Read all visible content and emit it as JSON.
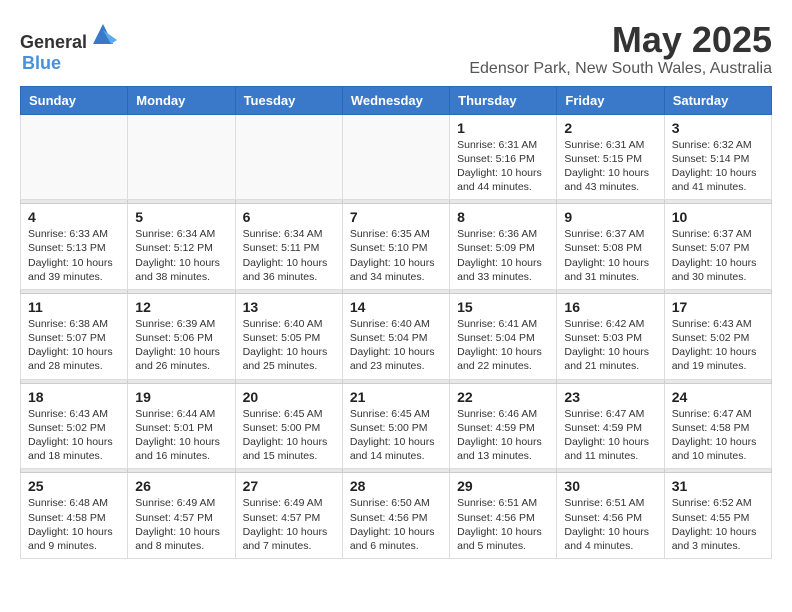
{
  "header": {
    "logo_general": "General",
    "logo_blue": "Blue",
    "month_title": "May 2025",
    "location": "Edensor Park, New South Wales, Australia"
  },
  "weekdays": [
    "Sunday",
    "Monday",
    "Tuesday",
    "Wednesday",
    "Thursday",
    "Friday",
    "Saturday"
  ],
  "weeks": [
    [
      {
        "day": "",
        "empty": true
      },
      {
        "day": "",
        "empty": true
      },
      {
        "day": "",
        "empty": true
      },
      {
        "day": "",
        "empty": true
      },
      {
        "day": "1",
        "sunrise": "Sunrise: 6:31 AM",
        "sunset": "Sunset: 5:16 PM",
        "daylight": "Daylight: 10 hours and 44 minutes."
      },
      {
        "day": "2",
        "sunrise": "Sunrise: 6:31 AM",
        "sunset": "Sunset: 5:15 PM",
        "daylight": "Daylight: 10 hours and 43 minutes."
      },
      {
        "day": "3",
        "sunrise": "Sunrise: 6:32 AM",
        "sunset": "Sunset: 5:14 PM",
        "daylight": "Daylight: 10 hours and 41 minutes."
      }
    ],
    [
      {
        "day": "4",
        "sunrise": "Sunrise: 6:33 AM",
        "sunset": "Sunset: 5:13 PM",
        "daylight": "Daylight: 10 hours and 39 minutes."
      },
      {
        "day": "5",
        "sunrise": "Sunrise: 6:34 AM",
        "sunset": "Sunset: 5:12 PM",
        "daylight": "Daylight: 10 hours and 38 minutes."
      },
      {
        "day": "6",
        "sunrise": "Sunrise: 6:34 AM",
        "sunset": "Sunset: 5:11 PM",
        "daylight": "Daylight: 10 hours and 36 minutes."
      },
      {
        "day": "7",
        "sunrise": "Sunrise: 6:35 AM",
        "sunset": "Sunset: 5:10 PM",
        "daylight": "Daylight: 10 hours and 34 minutes."
      },
      {
        "day": "8",
        "sunrise": "Sunrise: 6:36 AM",
        "sunset": "Sunset: 5:09 PM",
        "daylight": "Daylight: 10 hours and 33 minutes."
      },
      {
        "day": "9",
        "sunrise": "Sunrise: 6:37 AM",
        "sunset": "Sunset: 5:08 PM",
        "daylight": "Daylight: 10 hours and 31 minutes."
      },
      {
        "day": "10",
        "sunrise": "Sunrise: 6:37 AM",
        "sunset": "Sunset: 5:07 PM",
        "daylight": "Daylight: 10 hours and 30 minutes."
      }
    ],
    [
      {
        "day": "11",
        "sunrise": "Sunrise: 6:38 AM",
        "sunset": "Sunset: 5:07 PM",
        "daylight": "Daylight: 10 hours and 28 minutes."
      },
      {
        "day": "12",
        "sunrise": "Sunrise: 6:39 AM",
        "sunset": "Sunset: 5:06 PM",
        "daylight": "Daylight: 10 hours and 26 minutes."
      },
      {
        "day": "13",
        "sunrise": "Sunrise: 6:40 AM",
        "sunset": "Sunset: 5:05 PM",
        "daylight": "Daylight: 10 hours and 25 minutes."
      },
      {
        "day": "14",
        "sunrise": "Sunrise: 6:40 AM",
        "sunset": "Sunset: 5:04 PM",
        "daylight": "Daylight: 10 hours and 23 minutes."
      },
      {
        "day": "15",
        "sunrise": "Sunrise: 6:41 AM",
        "sunset": "Sunset: 5:04 PM",
        "daylight": "Daylight: 10 hours and 22 minutes."
      },
      {
        "day": "16",
        "sunrise": "Sunrise: 6:42 AM",
        "sunset": "Sunset: 5:03 PM",
        "daylight": "Daylight: 10 hours and 21 minutes."
      },
      {
        "day": "17",
        "sunrise": "Sunrise: 6:43 AM",
        "sunset": "Sunset: 5:02 PM",
        "daylight": "Daylight: 10 hours and 19 minutes."
      }
    ],
    [
      {
        "day": "18",
        "sunrise": "Sunrise: 6:43 AM",
        "sunset": "Sunset: 5:02 PM",
        "daylight": "Daylight: 10 hours and 18 minutes."
      },
      {
        "day": "19",
        "sunrise": "Sunrise: 6:44 AM",
        "sunset": "Sunset: 5:01 PM",
        "daylight": "Daylight: 10 hours and 16 minutes."
      },
      {
        "day": "20",
        "sunrise": "Sunrise: 6:45 AM",
        "sunset": "Sunset: 5:00 PM",
        "daylight": "Daylight: 10 hours and 15 minutes."
      },
      {
        "day": "21",
        "sunrise": "Sunrise: 6:45 AM",
        "sunset": "Sunset: 5:00 PM",
        "daylight": "Daylight: 10 hours and 14 minutes."
      },
      {
        "day": "22",
        "sunrise": "Sunrise: 6:46 AM",
        "sunset": "Sunset: 4:59 PM",
        "daylight": "Daylight: 10 hours and 13 minutes."
      },
      {
        "day": "23",
        "sunrise": "Sunrise: 6:47 AM",
        "sunset": "Sunset: 4:59 PM",
        "daylight": "Daylight: 10 hours and 11 minutes."
      },
      {
        "day": "24",
        "sunrise": "Sunrise: 6:47 AM",
        "sunset": "Sunset: 4:58 PM",
        "daylight": "Daylight: 10 hours and 10 minutes."
      }
    ],
    [
      {
        "day": "25",
        "sunrise": "Sunrise: 6:48 AM",
        "sunset": "Sunset: 4:58 PM",
        "daylight": "Daylight: 10 hours and 9 minutes."
      },
      {
        "day": "26",
        "sunrise": "Sunrise: 6:49 AM",
        "sunset": "Sunset: 4:57 PM",
        "daylight": "Daylight: 10 hours and 8 minutes."
      },
      {
        "day": "27",
        "sunrise": "Sunrise: 6:49 AM",
        "sunset": "Sunset: 4:57 PM",
        "daylight": "Daylight: 10 hours and 7 minutes."
      },
      {
        "day": "28",
        "sunrise": "Sunrise: 6:50 AM",
        "sunset": "Sunset: 4:56 PM",
        "daylight": "Daylight: 10 hours and 6 minutes."
      },
      {
        "day": "29",
        "sunrise": "Sunrise: 6:51 AM",
        "sunset": "Sunset: 4:56 PM",
        "daylight": "Daylight: 10 hours and 5 minutes."
      },
      {
        "day": "30",
        "sunrise": "Sunrise: 6:51 AM",
        "sunset": "Sunset: 4:56 PM",
        "daylight": "Daylight: 10 hours and 4 minutes."
      },
      {
        "day": "31",
        "sunrise": "Sunrise: 6:52 AM",
        "sunset": "Sunset: 4:55 PM",
        "daylight": "Daylight: 10 hours and 3 minutes."
      }
    ]
  ]
}
